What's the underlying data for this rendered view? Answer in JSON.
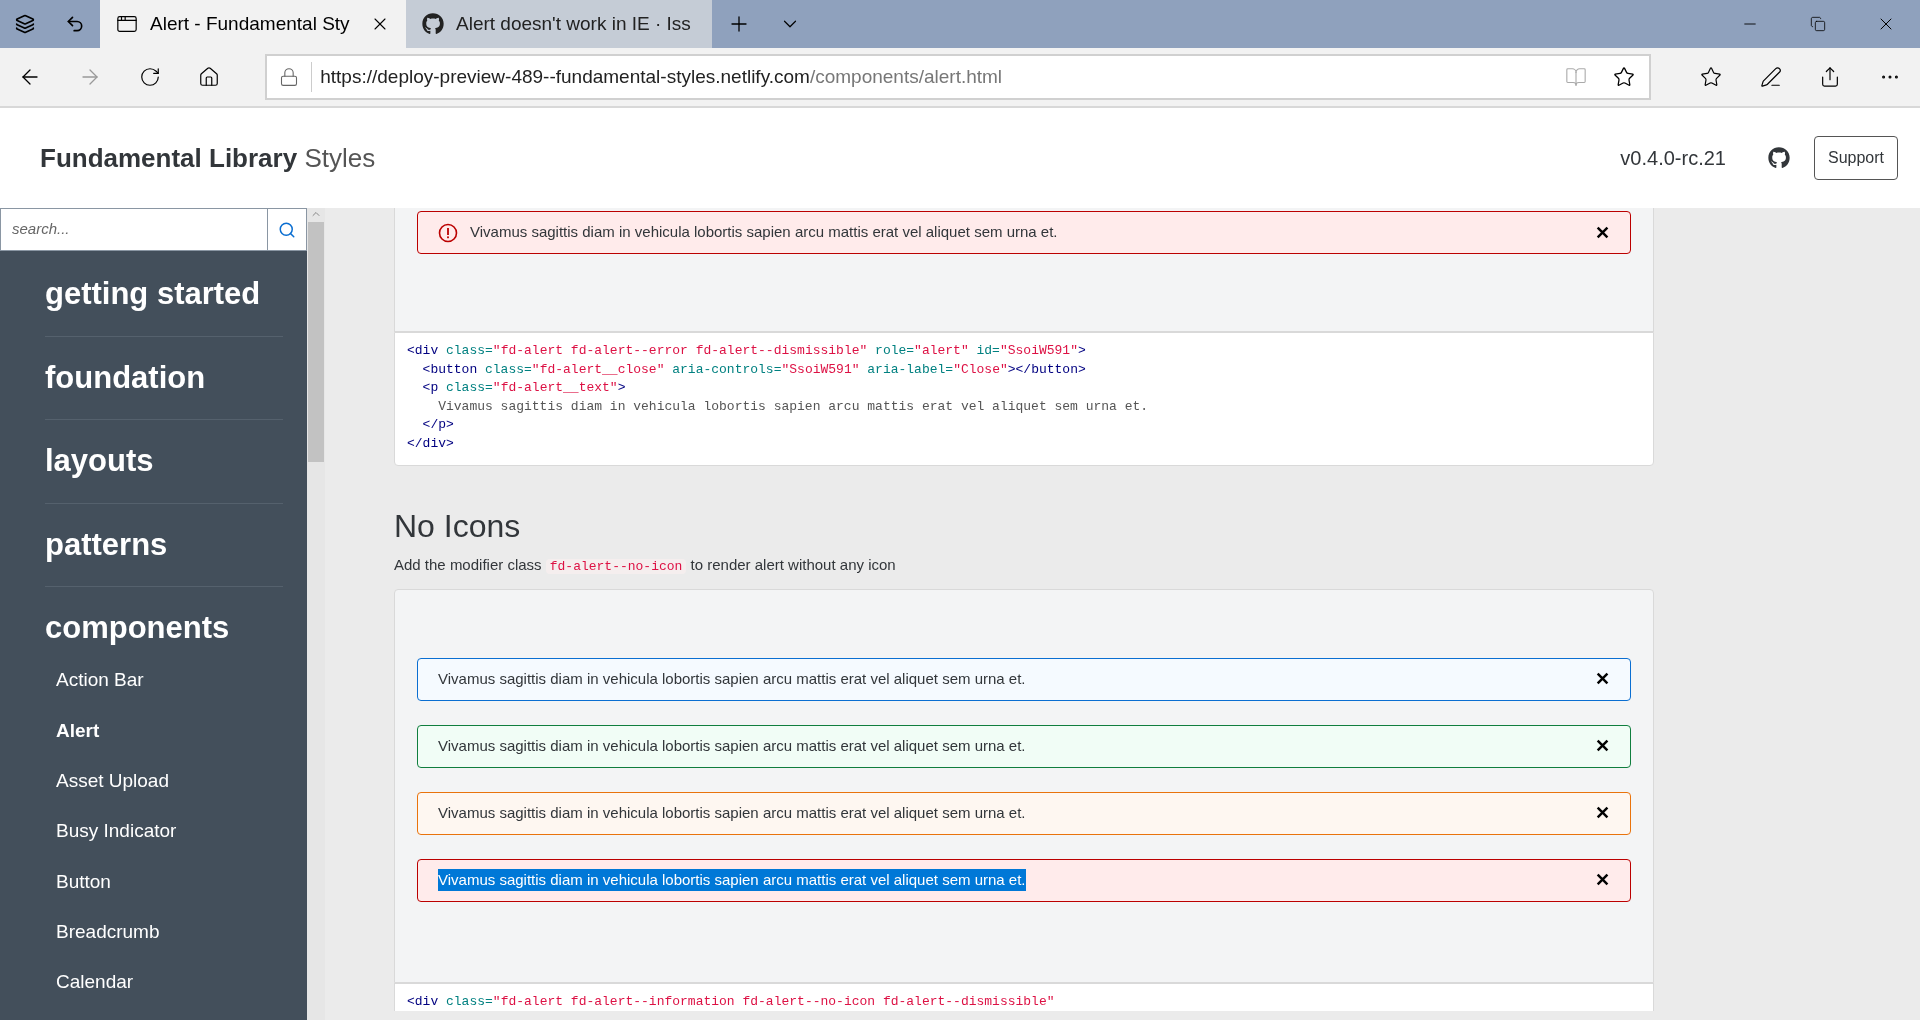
{
  "browser": {
    "tabs": [
      {
        "title": "Alert - Fundamental Sty",
        "selected": true
      },
      {
        "title": "Alert doesn't work in IE · Iss",
        "selected": false
      }
    ],
    "url_host": "https://deploy-preview-489--fundamental-styles.netlify.com",
    "url_path": "/components/alert.html"
  },
  "header": {
    "brand": "Fundamental Library",
    "brand_suffix": "Styles",
    "version": "v0.4.0-rc.21",
    "support_button": "Support"
  },
  "sidebar": {
    "search": {
      "placeholder": "search..."
    },
    "sections": [
      {
        "label": "getting started"
      },
      {
        "label": "foundation"
      },
      {
        "label": "layouts"
      },
      {
        "label": "patterns"
      },
      {
        "label": "components",
        "items": [
          {
            "label": "Action Bar",
            "selected": false
          },
          {
            "label": "Alert",
            "selected": true
          },
          {
            "label": "Asset Upload",
            "selected": false
          },
          {
            "label": "Busy Indicator",
            "selected": false
          },
          {
            "label": "Button",
            "selected": false
          },
          {
            "label": "Breadcrumb",
            "selected": false
          },
          {
            "label": "Calendar",
            "selected": false
          }
        ]
      }
    ]
  },
  "top_example": {
    "alerts": [
      {
        "kind": "error",
        "icon": true,
        "text": "Vivamus sagittis diam in vehicula lobortis sapien arcu mattis erat vel aliquet sem urna et.",
        "close": "✕",
        "highlighted": false
      }
    ],
    "code": [
      [
        {
          "kind": "tag",
          "text": "<div"
        },
        {
          "kind": "attr",
          "text": " class="
        },
        {
          "kind": "value",
          "text": "\"fd-alert fd-alert--error fd-alert--dismissible\""
        },
        {
          "kind": "attr",
          "text": " role="
        },
        {
          "kind": "value",
          "text": "\"alert\""
        },
        {
          "kind": "attr",
          "text": " id="
        },
        {
          "kind": "value",
          "text": "\"SsoiW591\""
        },
        {
          "kind": "tag",
          "text": ">"
        }
      ],
      [
        {
          "kind": "tag",
          "text": "  <button"
        },
        {
          "kind": "attr",
          "text": " class="
        },
        {
          "kind": "value",
          "text": "\"fd-alert__close\""
        },
        {
          "kind": "attr",
          "text": " aria-controls="
        },
        {
          "kind": "value",
          "text": "\"SsoiW591\""
        },
        {
          "kind": "attr",
          "text": " aria-label="
        },
        {
          "kind": "value",
          "text": "\"Close\""
        },
        {
          "kind": "tag",
          "text": "></button>"
        }
      ],
      [
        {
          "kind": "tag",
          "text": "  <p"
        },
        {
          "kind": "attr",
          "text": " class="
        },
        {
          "kind": "value",
          "text": "\"fd-alert__text\""
        },
        {
          "kind": "tag",
          "text": ">"
        }
      ],
      [
        {
          "kind": "text",
          "text": "    Vivamus sagittis diam in vehicula lobortis sapien arcu mattis erat vel aliquet sem urna et."
        }
      ],
      [
        {
          "kind": "tag",
          "text": "  </p>"
        }
      ],
      [
        {
          "kind": "tag",
          "text": "</div>"
        }
      ]
    ]
  },
  "no_icons": {
    "heading": "No Icons",
    "description_before": "Add the modifier class",
    "description_code": "fd-alert--no-icon",
    "description_after": "to render alert without any icon",
    "alerts": [
      {
        "kind": "information",
        "icon": false,
        "text": "Vivamus sagittis diam in vehicula lobortis sapien arcu mattis erat vel aliquet sem urna et.",
        "close": "✕",
        "highlighted": false
      },
      {
        "kind": "success",
        "icon": false,
        "text": "Vivamus sagittis diam in vehicula lobortis sapien arcu mattis erat vel aliquet sem urna et.",
        "close": "✕",
        "highlighted": false
      },
      {
        "kind": "warning",
        "icon": false,
        "text": "Vivamus sagittis diam in vehicula lobortis sapien arcu mattis erat vel aliquet sem urna et.",
        "close": "✕",
        "highlighted": false
      },
      {
        "kind": "error",
        "icon": false,
        "text": "Vivamus sagittis diam in vehicula lobortis sapien arcu mattis erat vel aliquet sem urna et.",
        "close": "✕",
        "highlighted": true
      }
    ],
    "code": [
      [
        {
          "kind": "tag",
          "text": "<div"
        },
        {
          "kind": "attr",
          "text": " class="
        },
        {
          "kind": "value",
          "text": "\"fd-alert fd-alert--information fd-alert--no-icon fd-alert--dismissible\""
        }
      ]
    ]
  }
}
